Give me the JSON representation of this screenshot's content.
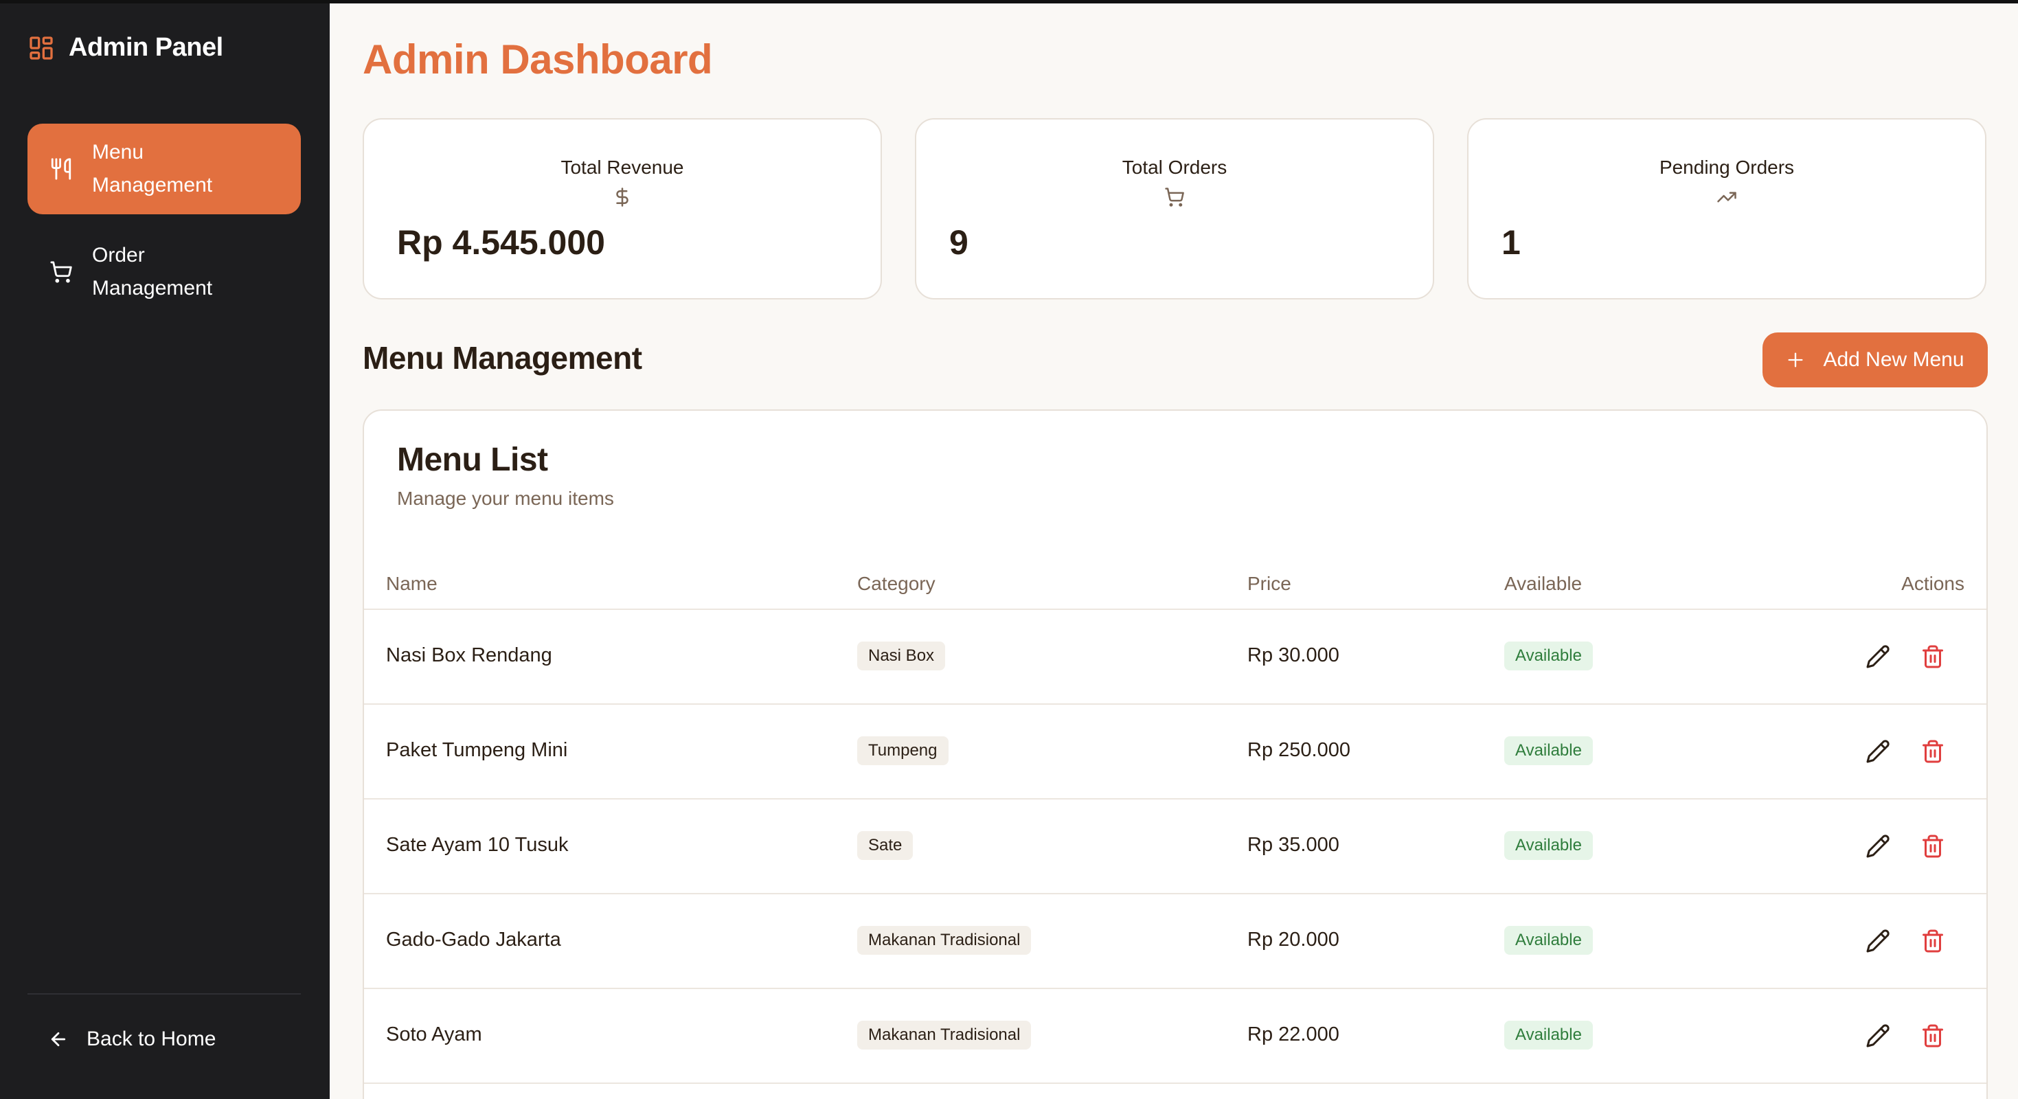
{
  "sidebar": {
    "title": "Admin Panel",
    "items": [
      {
        "label": "Menu Management",
        "icon": "utensils-icon",
        "active": true
      },
      {
        "label": "Order Management",
        "icon": "cart-icon",
        "active": false
      }
    ],
    "back_label": "Back to Home"
  },
  "page": {
    "title": "Admin Dashboard"
  },
  "stats": [
    {
      "label": "Total Revenue",
      "icon": "dollar-icon",
      "value": "Rp 4.545.000"
    },
    {
      "label": "Total Orders",
      "icon": "cart-icon",
      "value": "9"
    },
    {
      "label": "Pending Orders",
      "icon": "trending-up-icon",
      "value": "1"
    }
  ],
  "section": {
    "title": "Menu Management",
    "add_button": "Add New Menu"
  },
  "menu_list": {
    "title": "Menu List",
    "subtitle": "Manage your menu items",
    "columns": [
      "Name",
      "Category",
      "Price",
      "Available",
      "Actions"
    ],
    "rows": [
      {
        "name": "Nasi Box Rendang",
        "category": "Nasi Box",
        "price": "Rp 30.000",
        "available": "Available"
      },
      {
        "name": "Paket Tumpeng Mini",
        "category": "Tumpeng",
        "price": "Rp 250.000",
        "available": "Available"
      },
      {
        "name": "Sate Ayam 10 Tusuk",
        "category": "Sate",
        "price": "Rp 35.000",
        "available": "Available"
      },
      {
        "name": "Gado-Gado Jakarta",
        "category": "Makanan Tradisional",
        "price": "Rp 20.000",
        "available": "Available"
      },
      {
        "name": "Soto Ayam",
        "category": "Makanan Tradisional",
        "price": "Rp 22.000",
        "available": "Available"
      }
    ]
  },
  "colors": {
    "accent": "#e2703f",
    "sidebar_bg": "#1d1d1f",
    "page_bg": "#faf8f5",
    "available_bg": "#e6f5e8",
    "available_text": "#2f7d3c",
    "delete": "#e03e3e"
  }
}
